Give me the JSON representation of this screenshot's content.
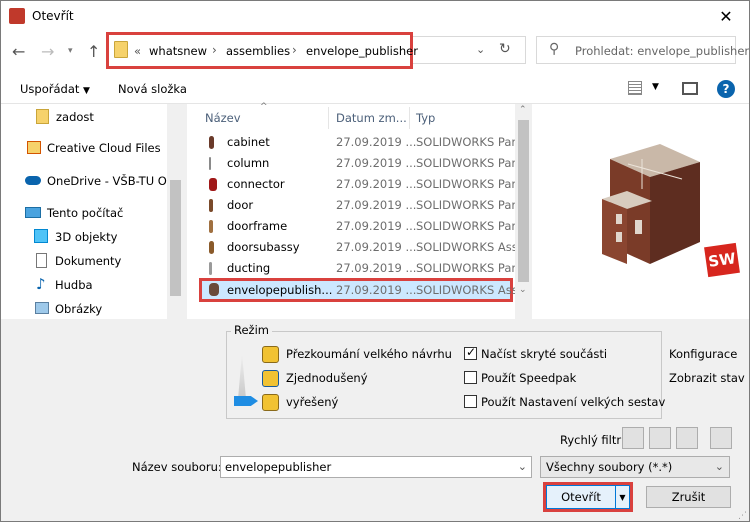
{
  "window": {
    "title": "Otevřít"
  },
  "address": {
    "overflow_marker": "«",
    "crumbs": [
      "whatsnew",
      "assemblies",
      "envelope_publisher"
    ]
  },
  "search": {
    "placeholder": "Prohledat: envelope_publisher"
  },
  "toolbar": {
    "organize_label": "Uspořádat",
    "new_folder_label": "Nová složka"
  },
  "nav": {
    "items": [
      {
        "label": "zadost"
      },
      {
        "label": "Creative Cloud Files"
      },
      {
        "label": "OneDrive - VŠB-TU Ost"
      },
      {
        "label": "Tento počítač"
      },
      {
        "label": "3D objekty"
      },
      {
        "label": "Dokumenty"
      },
      {
        "label": "Hudba"
      },
      {
        "label": "Obrázky"
      }
    ]
  },
  "files": {
    "columns": {
      "name": "Název",
      "date": "Datum zm...",
      "type": "Typ"
    },
    "rows": [
      {
        "name": "cabinet",
        "date": "27.09.2019 ...",
        "type": "SOLIDWORKS Part"
      },
      {
        "name": "column",
        "date": "27.09.2019 ...",
        "type": "SOLIDWORKS Part"
      },
      {
        "name": "connector",
        "date": "27.09.2019 ...",
        "type": "SOLIDWORKS Part"
      },
      {
        "name": "door",
        "date": "27.09.2019 ...",
        "type": "SOLIDWORKS Part"
      },
      {
        "name": "doorframe",
        "date": "27.09.2019 ...",
        "type": "SOLIDWORKS Part"
      },
      {
        "name": "doorsubassy",
        "date": "27.09.2019 ...",
        "type": "SOLIDWORKS Ass."
      },
      {
        "name": "ducting",
        "date": "27.09.2019 ...",
        "type": "SOLIDWORKS Part"
      },
      {
        "name": "envelopepublish...",
        "date": "27.09.2019 ...",
        "type": "SOLIDWORKS Ass."
      }
    ]
  },
  "preview": {
    "badge": "SW"
  },
  "mode": {
    "legend": "Režim",
    "options": [
      {
        "label": "Přezkoumání velkého návrhu"
      },
      {
        "label": "Zjednodušený"
      },
      {
        "label": "vyřešený"
      }
    ],
    "checks": [
      {
        "label": "Načíst skryté součásti",
        "checked": true
      },
      {
        "label": "Použít Speedpak",
        "checked": false
      },
      {
        "label": "Použít Nastavení velkých sestav",
        "checked": false
      }
    ],
    "right_labels": [
      "Konfigurace",
      "Zobrazit stav"
    ]
  },
  "quick_filter": {
    "label": "Rychlý filtr:"
  },
  "filename": {
    "label": "Název souboru:",
    "value": "envelopepublisher"
  },
  "filetype": {
    "value": "Všechny soubory (*.*)"
  },
  "buttons": {
    "open": "Otevřít",
    "cancel": "Zrušit"
  },
  "colors": {
    "accent": "#d9413e",
    "selection": "#cce8ff",
    "link_blue": "#0078d7"
  }
}
